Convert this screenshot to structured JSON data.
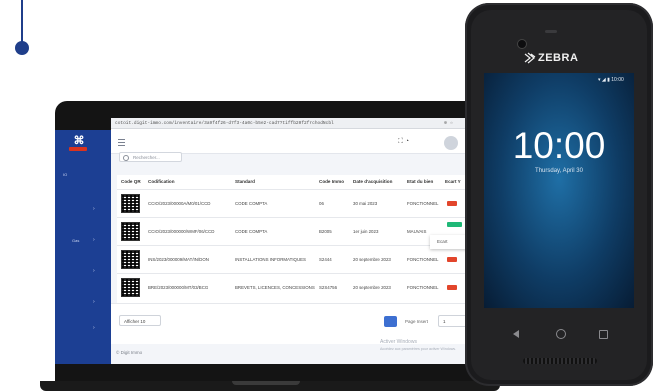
{
  "laptop": {
    "url": "cotoit.digit-immo.com/inventaire/3a9f4f26-d7f3-4a0c-b5e2-cad7?tiffb20f2frchodNcbl",
    "sidebar": {
      "logo_glyph": "⌘",
      "items": [
        {
          "label": "IO"
        },
        {
          "label": "Gas"
        }
      ]
    },
    "search": {
      "placeholder": "Rechercher..."
    },
    "table": {
      "columns": [
        "Code QR",
        "Codification",
        "Standard",
        "Code Immo",
        "Date d'acquisition",
        "Etat du bien",
        "Ecart Y"
      ],
      "rows": [
        {
          "codification": "CCIO/2023/00000A/M0/01/CCD",
          "standard": "CODE COMPTA",
          "code_immo": "06",
          "date": "30 mai 2023",
          "etat": "FONCTIONNEL",
          "badge_color": "#e2452b"
        },
        {
          "codification": "CCIO/2023/000000/WMF/06/CCD",
          "standard": "CODE COMPTA",
          "code_immo": "B2005",
          "date": "1er juin 2023",
          "etat": "MAUVAIS",
          "badge_color": "#1fb877"
        },
        {
          "codification": "INS/2023/000009/MAT/IN/DON",
          "standard": "INSTALLATIONS INFORMATIQUES",
          "code_immo": "S2444",
          "date": "20 septembre 2023",
          "etat": "FONCTIONNEL",
          "badge_color": "#e2452b"
        },
        {
          "codification": "BRE/2023/000000/MT/03/BCG",
          "standard": "BREVETS, LICENCES, CONCESSIONS",
          "code_immo": "S2S4756",
          "date": "20 septembre 2023",
          "etat": "FONCTIONNEL",
          "badge_color": "#e2452b"
        }
      ]
    },
    "popup": {
      "label": "Ecart"
    },
    "footer": {
      "per_page": "Afficher 10",
      "page_label": "Page Insert",
      "page_value": "1",
      "copyright": "© Digit Immo",
      "activate_title": "Activer Windows",
      "activate_sub": "Accédez aux paramètres pour activer Windows."
    }
  },
  "phone": {
    "brand": "ZEBRA",
    "status_time": "10:00",
    "clock": "10:00",
    "date": "Thursday, April 30"
  },
  "colors": {
    "sidebar": "#1c3f93",
    "accent": "#3d6fd1",
    "badge_red": "#e2452b",
    "badge_green": "#1fb877",
    "timeline": "#1f3e8a"
  }
}
